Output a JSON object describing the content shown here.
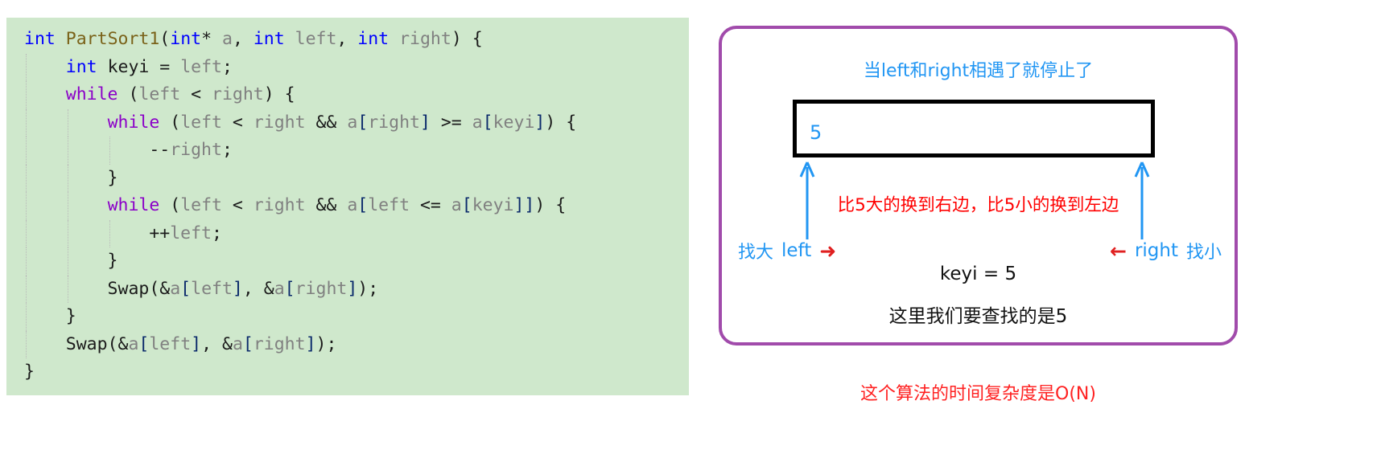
{
  "code": {
    "language": "c",
    "background_color": "#cfe8cc",
    "lines": [
      [
        {
          "t": "int",
          "c": "kw"
        },
        {
          "t": " ",
          "c": "plain"
        },
        {
          "t": "PartSort1",
          "c": "fn"
        },
        {
          "t": "(",
          "c": "plain"
        },
        {
          "t": "int",
          "c": "kw"
        },
        {
          "t": "* ",
          "c": "plain"
        },
        {
          "t": "a",
          "c": "ident"
        },
        {
          "t": ", ",
          "c": "plain"
        },
        {
          "t": "int",
          "c": "kw"
        },
        {
          "t": " ",
          "c": "plain"
        },
        {
          "t": "left",
          "c": "ident"
        },
        {
          "t": ", ",
          "c": "plain"
        },
        {
          "t": "int",
          "c": "kw"
        },
        {
          "t": " ",
          "c": "plain"
        },
        {
          "t": "right",
          "c": "ident"
        },
        {
          "t": ") {",
          "c": "plain"
        }
      ],
      [
        {
          "t": "    ",
          "c": "plain"
        },
        {
          "t": "int",
          "c": "kw"
        },
        {
          "t": " keyi = ",
          "c": "plain"
        },
        {
          "t": "left",
          "c": "ident"
        },
        {
          "t": ";",
          "c": "plain"
        }
      ],
      [
        {
          "t": "    ",
          "c": "plain"
        },
        {
          "t": "while",
          "c": "ctrl"
        },
        {
          "t": " (",
          "c": "plain"
        },
        {
          "t": "left",
          "c": "ident"
        },
        {
          "t": " < ",
          "c": "plain"
        },
        {
          "t": "right",
          "c": "ident"
        },
        {
          "t": ") {",
          "c": "plain"
        }
      ],
      [
        {
          "t": "        ",
          "c": "plain"
        },
        {
          "t": "while",
          "c": "ctrl"
        },
        {
          "t": " (",
          "c": "plain"
        },
        {
          "t": "left",
          "c": "ident"
        },
        {
          "t": " < ",
          "c": "plain"
        },
        {
          "t": "right",
          "c": "ident"
        },
        {
          "t": " && ",
          "c": "plain"
        },
        {
          "t": "a",
          "c": "ident"
        },
        {
          "t": "[",
          "c": "brk"
        },
        {
          "t": "right",
          "c": "ident"
        },
        {
          "t": "]",
          "c": "brk"
        },
        {
          "t": " >= ",
          "c": "plain"
        },
        {
          "t": "a",
          "c": "ident"
        },
        {
          "t": "[",
          "c": "brk"
        },
        {
          "t": "keyi",
          "c": "ident"
        },
        {
          "t": "]",
          "c": "brk"
        },
        {
          "t": ") {",
          "c": "plain"
        }
      ],
      [
        {
          "t": "            --",
          "c": "plain"
        },
        {
          "t": "right",
          "c": "ident"
        },
        {
          "t": ";",
          "c": "plain"
        }
      ],
      [
        {
          "t": "        }",
          "c": "plain"
        }
      ],
      [
        {
          "t": "        ",
          "c": "plain"
        },
        {
          "t": "while",
          "c": "ctrl"
        },
        {
          "t": " (",
          "c": "plain"
        },
        {
          "t": "left",
          "c": "ident"
        },
        {
          "t": " < ",
          "c": "plain"
        },
        {
          "t": "right",
          "c": "ident"
        },
        {
          "t": " && ",
          "c": "plain"
        },
        {
          "t": "a",
          "c": "ident"
        },
        {
          "t": "[",
          "c": "brk"
        },
        {
          "t": "left",
          "c": "ident"
        },
        {
          "t": " <= ",
          "c": "plain"
        },
        {
          "t": "a",
          "c": "ident"
        },
        {
          "t": "[",
          "c": "brk"
        },
        {
          "t": "keyi",
          "c": "ident"
        },
        {
          "t": "]]",
          "c": "brk"
        },
        {
          "t": ") {",
          "c": "plain"
        }
      ],
      [
        {
          "t": "            ++",
          "c": "plain"
        },
        {
          "t": "left",
          "c": "ident"
        },
        {
          "t": ";",
          "c": "plain"
        }
      ],
      [
        {
          "t": "        }",
          "c": "plain"
        }
      ],
      [
        {
          "t": "        Swap(&",
          "c": "plain"
        },
        {
          "t": "a",
          "c": "ident"
        },
        {
          "t": "[",
          "c": "brk"
        },
        {
          "t": "left",
          "c": "ident"
        },
        {
          "t": "]",
          "c": "brk"
        },
        {
          "t": ", &",
          "c": "plain"
        },
        {
          "t": "a",
          "c": "ident"
        },
        {
          "t": "[",
          "c": "brk"
        },
        {
          "t": "right",
          "c": "ident"
        },
        {
          "t": "]",
          "c": "brk"
        },
        {
          "t": ");",
          "c": "plain"
        }
      ],
      [
        {
          "t": "    }",
          "c": "plain"
        }
      ],
      [
        {
          "t": "    Swap(&",
          "c": "plain"
        },
        {
          "t": "a",
          "c": "ident"
        },
        {
          "t": "[",
          "c": "brk"
        },
        {
          "t": "left",
          "c": "ident"
        },
        {
          "t": "]",
          "c": "brk"
        },
        {
          "t": ", &",
          "c": "plain"
        },
        {
          "t": "a",
          "c": "ident"
        },
        {
          "t": "[",
          "c": "brk"
        },
        {
          "t": "right",
          "c": "ident"
        },
        {
          "t": "]",
          "c": "brk"
        },
        {
          "t": ");",
          "c": "plain"
        }
      ],
      [
        {
          "t": "}",
          "c": "plain"
        }
      ]
    ]
  },
  "diagram": {
    "border_color": "#a14bab",
    "title": "当left和right相遇了就停止了",
    "title_color": "#2196f3",
    "array": {
      "value": "5",
      "value_color": "#2196f3",
      "border_color": "#000000"
    },
    "swap_note": "比5大的换到右边，比5小的换到左边",
    "swap_note_color": "#ff0000",
    "left_marker": {
      "find_label": "找大",
      "name": "left",
      "arrow": "➜",
      "arrow_color": "#e02020",
      "label_color": "#2196f3"
    },
    "right_marker": {
      "find_label": "找小",
      "name": "right",
      "arrow": "←",
      "arrow_color": "#e02020",
      "label_color": "#2196f3"
    },
    "keyi_label": "keyi = 5",
    "search_note": "这里我们要查找的是5",
    "pointer_arrow_color": "#2196f3"
  },
  "complexity_note": "这个算法的时间复杂度是O(N)",
  "complexity_note_color": "#ff2222"
}
